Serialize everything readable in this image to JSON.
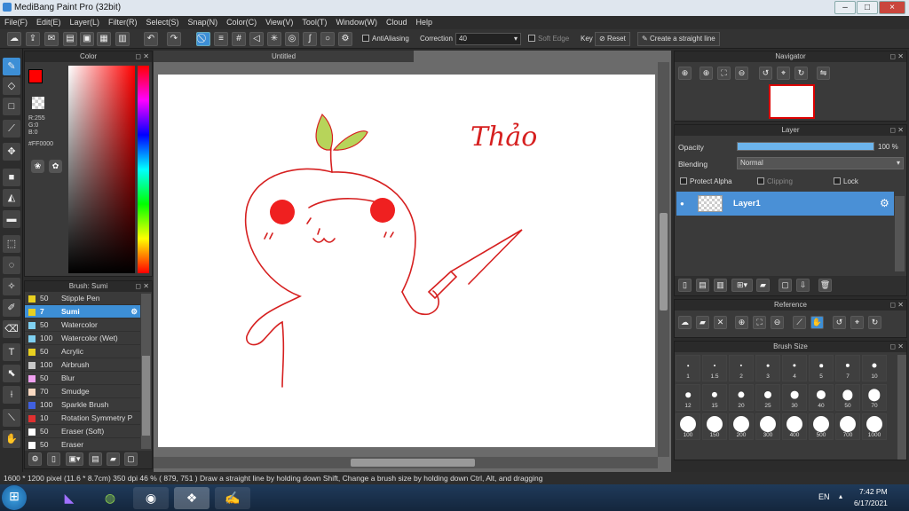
{
  "window": {
    "title": "MediBang Paint Pro (32bit)",
    "min": "–",
    "max": "□",
    "close": "×"
  },
  "menu": [
    "File(F)",
    "Edit(E)",
    "Layer(L)",
    "Filter(R)",
    "Select(S)",
    "Snap(N)",
    "Color(C)",
    "View(V)",
    "Tool(T)",
    "Window(W)",
    "Cloud",
    "Help"
  ],
  "toolbar": {
    "antialiasing": "AntiAliasing",
    "correction_label": "Correction",
    "correction_value": "40",
    "soft_edge": "Soft Edge",
    "key": "Key",
    "reset": "Reset",
    "straight_line": "Create a straight line"
  },
  "color": {
    "title": "Color",
    "fg": "#FF0000",
    "r": "R:255",
    "g": "G:0",
    "b": "B:0",
    "hex": "#FF0000"
  },
  "brush": {
    "title": "Brush: Sumi",
    "items": [
      {
        "size": "50",
        "name": "Stipple Pen",
        "color": "#e8d020"
      },
      {
        "size": "7",
        "name": "Sumi",
        "color": "#e8d020",
        "selected": true
      },
      {
        "size": "50",
        "name": "Watercolor",
        "color": "#7fd0f0"
      },
      {
        "size": "100",
        "name": "Watercolor (Wet)",
        "color": "#7fd0f0"
      },
      {
        "size": "50",
        "name": "Acrylic",
        "color": "#e8d020"
      },
      {
        "size": "100",
        "name": "Airbrush",
        "color": "#c8c8c8"
      },
      {
        "size": "50",
        "name": "Blur",
        "color": "#f0a0f0"
      },
      {
        "size": "70",
        "name": "Smudge",
        "color": "#f8d8c0"
      },
      {
        "size": "100",
        "name": "Sparkle Brush",
        "color": "#4060e0"
      },
      {
        "size": "10",
        "name": "Rotation Symmetry P",
        "color": "#e03030"
      },
      {
        "size": "50",
        "name": "Eraser (Soft)",
        "color": "#ffffff"
      },
      {
        "size": "50",
        "name": "Eraser",
        "color": "#ffffff"
      }
    ]
  },
  "canvas": {
    "tab": "Untitled",
    "handwriting": "Thảo"
  },
  "navigator": {
    "title": "Navigator"
  },
  "layer": {
    "title": "Layer",
    "opacity_label": "Opacity",
    "opacity_value": "100 %",
    "opacity_level": 1.0,
    "blending_label": "Blending",
    "blending_value": "Normal",
    "protect_alpha": "Protect Alpha",
    "clipping": "Clipping",
    "lock": "Lock",
    "layer_name": "Layer1"
  },
  "reference": {
    "title": "Reference"
  },
  "brush_size": {
    "title": "Brush Size",
    "sizes": [
      "1",
      "1.5",
      "2",
      "3",
      "4",
      "5",
      "7",
      "10",
      "12",
      "15",
      "20",
      "25",
      "30",
      "40",
      "50",
      "70",
      "100",
      "150",
      "200",
      "300",
      "400",
      "500",
      "700",
      "1000"
    ]
  },
  "status": "1600 * 1200 pixel  (11.6 * 8.7cm)  350 dpi  46 %  ( 879, 751 )  Draw a straight line by holding down Shift, Change a brush size by holding down Ctrl, Alt, and dragging",
  "taskbar": {
    "lang": "EN",
    "time": "7:42 PM",
    "date": "6/17/2021"
  }
}
